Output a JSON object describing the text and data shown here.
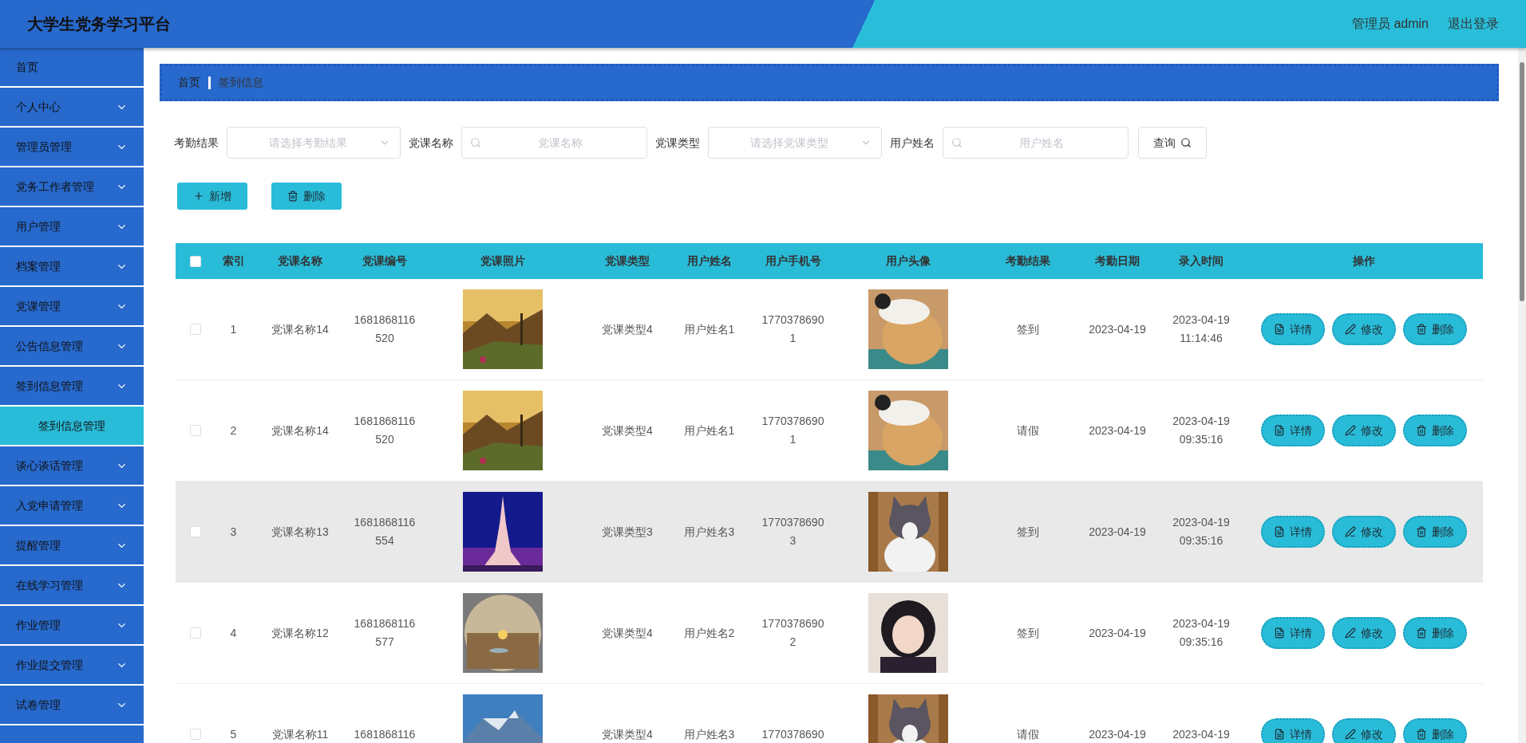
{
  "header": {
    "title": "大学生党务学习平台",
    "user": "管理员 admin",
    "logout": "退出登录"
  },
  "sidebar": {
    "items": [
      {
        "label": "首页",
        "kind": "link"
      },
      {
        "label": "个人中心",
        "kind": "menu"
      },
      {
        "label": "管理员管理",
        "kind": "menu"
      },
      {
        "label": "党务工作者管理",
        "kind": "menu"
      },
      {
        "label": "用户管理",
        "kind": "menu"
      },
      {
        "label": "档案管理",
        "kind": "menu"
      },
      {
        "label": "党课管理",
        "kind": "menu"
      },
      {
        "label": "公告信息管理",
        "kind": "menu"
      },
      {
        "label": "签到信息管理",
        "kind": "menu",
        "children": [
          {
            "label": "签到信息管理",
            "selected": true
          }
        ]
      },
      {
        "label": "谈心谈话管理",
        "kind": "menu"
      },
      {
        "label": "入党申请管理",
        "kind": "menu"
      },
      {
        "label": "提醒管理",
        "kind": "menu"
      },
      {
        "label": "在线学习管理",
        "kind": "menu"
      },
      {
        "label": "作业管理",
        "kind": "menu"
      },
      {
        "label": "作业提交管理",
        "kind": "menu"
      },
      {
        "label": "试卷管理",
        "kind": "menu"
      }
    ]
  },
  "breadcrumb": [
    "首页",
    "签到信息"
  ],
  "filters": [
    {
      "label": "考勤结果",
      "kind": "select",
      "placeholder": "请选择考勤结果"
    },
    {
      "label": "党课名称",
      "kind": "search",
      "placeholder": "党课名称"
    },
    {
      "label": "党课类型",
      "kind": "select",
      "placeholder": "请选择党课类型"
    },
    {
      "label": "用户姓名",
      "kind": "search",
      "placeholder": "用户姓名"
    }
  ],
  "query_button": "查询",
  "actions": [
    {
      "label": "新增",
      "kind": "add"
    },
    {
      "label": "删除",
      "kind": "delete"
    }
  ],
  "table": {
    "select_all": {
      "checked": false
    },
    "columns": [
      "索引",
      "党课名称",
      "党课编号",
      "党课照片",
      "党课类型",
      "用户姓名",
      "用户手机号",
      "用户头像",
      "考勤结果",
      "考勤日期",
      "录入时间",
      "操作"
    ],
    "rows": [
      {
        "checked": false,
        "hovered": false,
        "index": "1",
        "name": "党课名称14",
        "code": [
          "1681868116",
          "520"
        ],
        "type": "党课类型4",
        "user": "用户姓名1",
        "phone": [
          "1770378690",
          "1"
        ],
        "result": "签到",
        "date": "2023-04-19",
        "time": [
          "2023-04-19",
          "11:14:46"
        ],
        "buttons": [
          "详情",
          "修改",
          "删除"
        ]
      },
      {
        "checked": false,
        "hovered": false,
        "index": "2",
        "name": "党课名称14",
        "code": [
          "1681868116",
          "520"
        ],
        "type": "党课类型4",
        "user": "用户姓名1",
        "phone": [
          "1770378690",
          "1"
        ],
        "result": "请假",
        "date": "2023-04-19",
        "time": [
          "2023-04-19",
          "09:35:16"
        ],
        "buttons": [
          "详情",
          "修改",
          "删除"
        ]
      },
      {
        "checked": false,
        "hovered": true,
        "index": "3",
        "name": "党课名称13",
        "code": [
          "1681868116",
          "554"
        ],
        "type": "党课类型3",
        "user": "用户姓名3",
        "phone": [
          "1770378690",
          "3"
        ],
        "result": "签到",
        "date": "2023-04-19",
        "time": [
          "2023-04-19",
          "09:35:16"
        ],
        "buttons": [
          "详情",
          "修改",
          "删除"
        ]
      },
      {
        "checked": false,
        "hovered": false,
        "index": "4",
        "name": "党课名称12",
        "code": [
          "1681868116",
          "577"
        ],
        "type": "党课类型4",
        "user": "用户姓名2",
        "phone": [
          "1770378690",
          "2"
        ],
        "result": "签到",
        "date": "2023-04-19",
        "time": [
          "2023-04-19",
          "09:35:16"
        ],
        "buttons": [
          "详情",
          "修改",
          "删除"
        ]
      },
      {
        "checked": false,
        "hovered": false,
        "index": "5",
        "name": "党课名称11",
        "code": [
          "1681868116"
        ],
        "type": "党课类型4",
        "user": "用户姓名3",
        "phone": [
          "1770378690"
        ],
        "result": "请假",
        "date": "2023-04-19",
        "time": [
          "2023-04-19"
        ],
        "buttons": [
          "详情",
          "修改",
          "删除"
        ]
      }
    ]
  }
}
